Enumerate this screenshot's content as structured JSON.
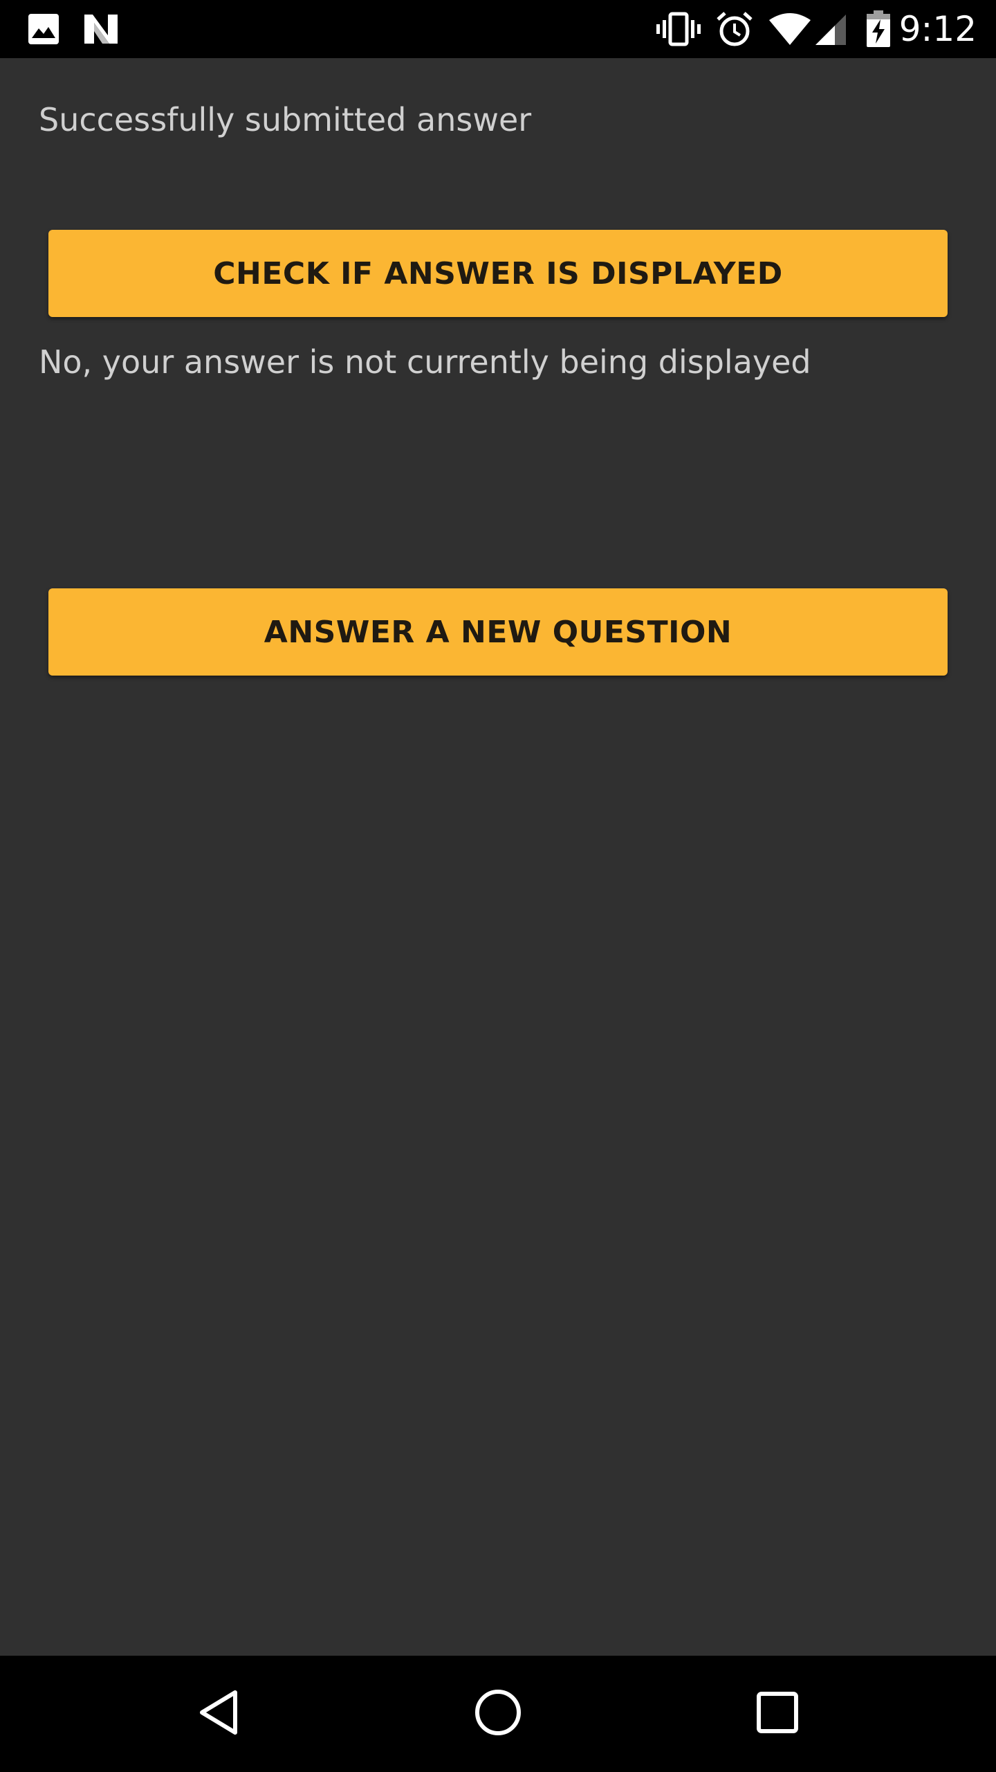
{
  "status_bar": {
    "time": "9:12",
    "left_icons": [
      "image-icon",
      "n-notification-icon"
    ],
    "right_icons": [
      "vibrate-icon",
      "alarm-icon",
      "wifi-icon",
      "cell-signal-icon",
      "battery-charging-icon"
    ]
  },
  "main": {
    "status_message": "Successfully submitted answer",
    "check_button_label": "CHECK IF ANSWER IS DISPLAYED",
    "display_result": "No, your answer is not currently being displayed",
    "new_question_button_label": "ANSWER A NEW QUESTION"
  },
  "nav_bar": {
    "icons": [
      "back-icon",
      "home-icon",
      "recents-icon"
    ]
  },
  "colors": {
    "background": "#303030",
    "accent": "#FBB633",
    "text": "#d0d0d0",
    "button_text": "#1f1a12",
    "bars": "#000000"
  }
}
